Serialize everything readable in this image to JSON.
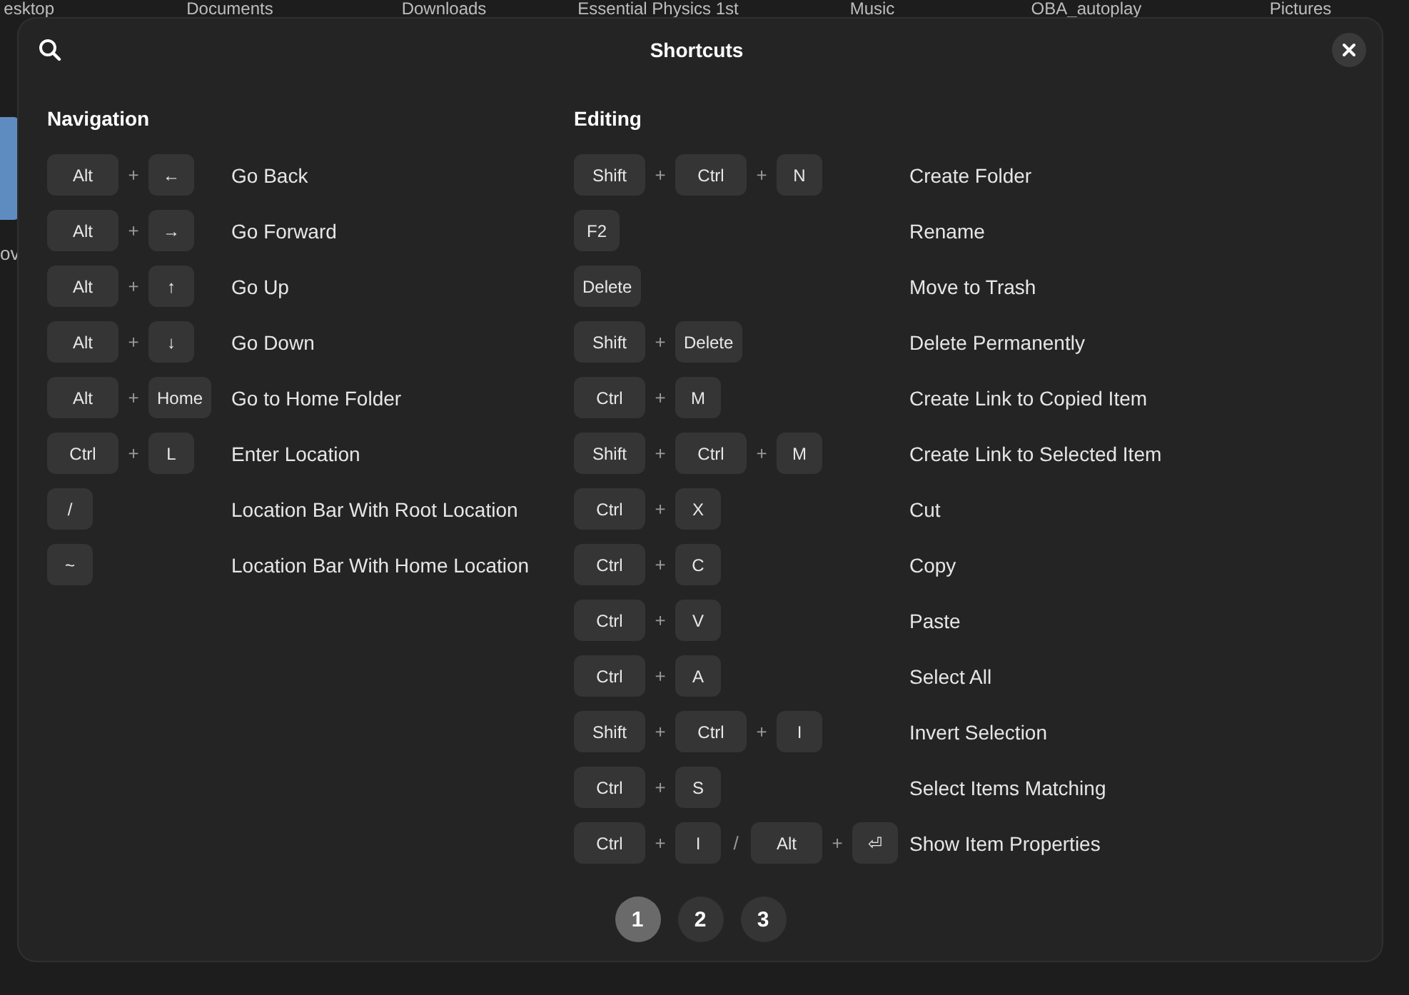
{
  "background": {
    "folder_labels": [
      "esktop",
      "Documents",
      "Downloads",
      "Essential Physics 1st",
      "Music",
      "OBA_autoplay",
      "Pictures"
    ],
    "partial_label": "ov"
  },
  "dialog": {
    "title": "Shortcuts",
    "sections": [
      {
        "title": "Navigation",
        "shortcuts": [
          {
            "keys": [
              {
                "kind": "modifier",
                "text": "Alt"
              },
              {
                "kind": "sep",
                "text": "+"
              },
              {
                "kind": "key",
                "text": "←"
              }
            ],
            "description": "Go Back"
          },
          {
            "keys": [
              {
                "kind": "modifier",
                "text": "Alt"
              },
              {
                "kind": "sep",
                "text": "+"
              },
              {
                "kind": "key",
                "text": "→"
              }
            ],
            "description": "Go Forward"
          },
          {
            "keys": [
              {
                "kind": "modifier",
                "text": "Alt"
              },
              {
                "kind": "sep",
                "text": "+"
              },
              {
                "kind": "key",
                "text": "↑"
              }
            ],
            "description": "Go Up"
          },
          {
            "keys": [
              {
                "kind": "modifier",
                "text": "Alt"
              },
              {
                "kind": "sep",
                "text": "+"
              },
              {
                "kind": "key",
                "text": "↓"
              }
            ],
            "description": "Go Down"
          },
          {
            "keys": [
              {
                "kind": "modifier",
                "text": "Alt"
              },
              {
                "kind": "sep",
                "text": "+"
              },
              {
                "kind": "key",
                "text": "Home"
              }
            ],
            "description": "Go to Home Folder"
          },
          {
            "keys": [
              {
                "kind": "modifier",
                "text": "Ctrl"
              },
              {
                "kind": "sep",
                "text": "+"
              },
              {
                "kind": "key",
                "text": "L"
              }
            ],
            "description": "Enter Location"
          },
          {
            "keys": [
              {
                "kind": "key",
                "text": "/"
              }
            ],
            "description": "Location Bar With Root Location"
          },
          {
            "keys": [
              {
                "kind": "key",
                "text": "~"
              }
            ],
            "description": "Location Bar With Home Location"
          }
        ]
      },
      {
        "title": "Editing",
        "shortcuts": [
          {
            "keys": [
              {
                "kind": "modifier",
                "text": "Shift"
              },
              {
                "kind": "sep",
                "text": "+"
              },
              {
                "kind": "modifier",
                "text": "Ctrl"
              },
              {
                "kind": "sep",
                "text": "+"
              },
              {
                "kind": "key",
                "text": "N"
              }
            ],
            "description": "Create Folder"
          },
          {
            "keys": [
              {
                "kind": "key",
                "text": "F2"
              }
            ],
            "description": "Rename"
          },
          {
            "keys": [
              {
                "kind": "key",
                "text": "Delete"
              }
            ],
            "description": "Move to Trash"
          },
          {
            "keys": [
              {
                "kind": "modifier",
                "text": "Shift"
              },
              {
                "kind": "sep",
                "text": "+"
              },
              {
                "kind": "key",
                "text": "Delete"
              }
            ],
            "description": "Delete Permanently"
          },
          {
            "keys": [
              {
                "kind": "modifier",
                "text": "Ctrl"
              },
              {
                "kind": "sep",
                "text": "+"
              },
              {
                "kind": "key",
                "text": "M"
              }
            ],
            "description": "Create Link to Copied Item"
          },
          {
            "keys": [
              {
                "kind": "modifier",
                "text": "Shift"
              },
              {
                "kind": "sep",
                "text": "+"
              },
              {
                "kind": "modifier",
                "text": "Ctrl"
              },
              {
                "kind": "sep",
                "text": "+"
              },
              {
                "kind": "key",
                "text": "M"
              }
            ],
            "description": "Create Link to Selected Item"
          },
          {
            "keys": [
              {
                "kind": "modifier",
                "text": "Ctrl"
              },
              {
                "kind": "sep",
                "text": "+"
              },
              {
                "kind": "key",
                "text": "X"
              }
            ],
            "description": "Cut"
          },
          {
            "keys": [
              {
                "kind": "modifier",
                "text": "Ctrl"
              },
              {
                "kind": "sep",
                "text": "+"
              },
              {
                "kind": "key",
                "text": "C"
              }
            ],
            "description": "Copy"
          },
          {
            "keys": [
              {
                "kind": "modifier",
                "text": "Ctrl"
              },
              {
                "kind": "sep",
                "text": "+"
              },
              {
                "kind": "key",
                "text": "V"
              }
            ],
            "description": "Paste"
          },
          {
            "keys": [
              {
                "kind": "modifier",
                "text": "Ctrl"
              },
              {
                "kind": "sep",
                "text": "+"
              },
              {
                "kind": "key",
                "text": "A"
              }
            ],
            "description": "Select All"
          },
          {
            "keys": [
              {
                "kind": "modifier",
                "text": "Shift"
              },
              {
                "kind": "sep",
                "text": "+"
              },
              {
                "kind": "modifier",
                "text": "Ctrl"
              },
              {
                "kind": "sep",
                "text": "+"
              },
              {
                "kind": "key",
                "text": "I"
              }
            ],
            "description": "Invert Selection"
          },
          {
            "keys": [
              {
                "kind": "modifier",
                "text": "Ctrl"
              },
              {
                "kind": "sep",
                "text": "+"
              },
              {
                "kind": "key",
                "text": "S"
              }
            ],
            "description": "Select Items Matching"
          },
          {
            "keys": [
              {
                "kind": "modifier",
                "text": "Ctrl"
              },
              {
                "kind": "sep",
                "text": "+"
              },
              {
                "kind": "key",
                "text": "I"
              },
              {
                "kind": "sep",
                "text": "/"
              },
              {
                "kind": "modifier",
                "text": "Alt"
              },
              {
                "kind": "sep",
                "text": "+"
              },
              {
                "kind": "key",
                "text": "⏎"
              }
            ],
            "description": "Show Item Properties"
          }
        ]
      }
    ],
    "pages": [
      {
        "label": "1",
        "selected": true
      },
      {
        "label": "2",
        "selected": false
      },
      {
        "label": "3",
        "selected": false
      }
    ]
  }
}
